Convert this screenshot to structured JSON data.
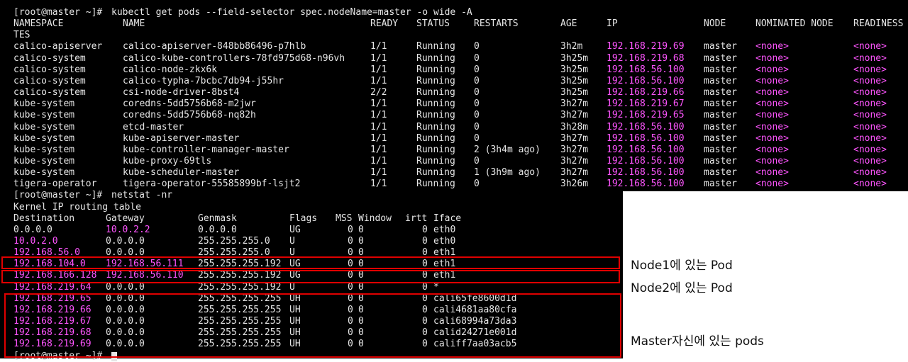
{
  "terminal": {
    "prompt1": "[root@master ~]# ",
    "cmd1": "kubectl get pods --field-selector spec.nodeName=master -o wide -A",
    "headers": {
      "namespace": "NAMESPACE",
      "name": "NAME",
      "ready": "READY",
      "status": "STATUS",
      "restarts": "RESTARTS",
      "age": "AGE",
      "ip": "IP",
      "node": "NODE",
      "nominated": "NOMINATED NODE",
      "readiness": "READINESS",
      "readiness_wrap": "TES"
    },
    "pods": [
      {
        "ns": "calico-apiserver",
        "name": "calico-apiserver-848bb86496-p7hlb",
        "ready": "1/1",
        "status": "Running",
        "restarts": "0",
        "age": "3h2m",
        "ip": "192.168.219.69",
        "node": "master",
        "nominated": "<none>",
        "readiness": "<none>"
      },
      {
        "ns": "calico-system",
        "name": "calico-kube-controllers-78fd975d68-n96vh",
        "ready": "1/1",
        "status": "Running",
        "restarts": "0",
        "age": "3h25m",
        "ip": "192.168.219.68",
        "node": "master",
        "nominated": "<none>",
        "readiness": "<none>"
      },
      {
        "ns": "calico-system",
        "name": "calico-node-zkx6k",
        "ready": "1/1",
        "status": "Running",
        "restarts": "0",
        "age": "3h25m",
        "ip": "192.168.56.100",
        "node": "master",
        "nominated": "<none>",
        "readiness": "<none>"
      },
      {
        "ns": "calico-system",
        "name": "calico-typha-7bcbc7db94-j55hr",
        "ready": "1/1",
        "status": "Running",
        "restarts": "0",
        "age": "3h25m",
        "ip": "192.168.56.100",
        "node": "master",
        "nominated": "<none>",
        "readiness": "<none>"
      },
      {
        "ns": "calico-system",
        "name": "csi-node-driver-8bst4",
        "ready": "2/2",
        "status": "Running",
        "restarts": "0",
        "age": "3h25m",
        "ip": "192.168.219.66",
        "node": "master",
        "nominated": "<none>",
        "readiness": "<none>"
      },
      {
        "ns": "kube-system",
        "name": "coredns-5dd5756b68-m2jwr",
        "ready": "1/1",
        "status": "Running",
        "restarts": "0",
        "age": "3h27m",
        "ip": "192.168.219.67",
        "node": "master",
        "nominated": "<none>",
        "readiness": "<none>"
      },
      {
        "ns": "kube-system",
        "name": "coredns-5dd5756b68-nq82h",
        "ready": "1/1",
        "status": "Running",
        "restarts": "0",
        "age": "3h27m",
        "ip": "192.168.219.65",
        "node": "master",
        "nominated": "<none>",
        "readiness": "<none>"
      },
      {
        "ns": "kube-system",
        "name": "etcd-master",
        "ready": "1/1",
        "status": "Running",
        "restarts": "0",
        "age": "3h28m",
        "ip": "192.168.56.100",
        "node": "master",
        "nominated": "<none>",
        "readiness": "<none>"
      },
      {
        "ns": "kube-system",
        "name": "kube-apiserver-master",
        "ready": "1/1",
        "status": "Running",
        "restarts": "0",
        "age": "3h27m",
        "ip": "192.168.56.100",
        "node": "master",
        "nominated": "<none>",
        "readiness": "<none>"
      },
      {
        "ns": "kube-system",
        "name": "kube-controller-manager-master",
        "ready": "1/1",
        "status": "Running",
        "restarts": "2 (3h4m ago)",
        "age": "3h27m",
        "ip": "192.168.56.100",
        "node": "master",
        "nominated": "<none>",
        "readiness": "<none>"
      },
      {
        "ns": "kube-system",
        "name": "kube-proxy-69tls",
        "ready": "1/1",
        "status": "Running",
        "restarts": "0",
        "age": "3h27m",
        "ip": "192.168.56.100",
        "node": "master",
        "nominated": "<none>",
        "readiness": "<none>"
      },
      {
        "ns": "kube-system",
        "name": "kube-scheduler-master",
        "ready": "1/1",
        "status": "Running",
        "restarts": "1 (3h9m ago)",
        "age": "3h27m",
        "ip": "192.168.56.100",
        "node": "master",
        "nominated": "<none>",
        "readiness": "<none>"
      },
      {
        "ns": "tigera-operator",
        "name": "tigera-operator-55585899bf-lsjt2",
        "ready": "1/1",
        "status": "Running",
        "restarts": "0",
        "age": "3h26m",
        "ip": "192.168.56.100",
        "node": "master",
        "nominated": "<none>",
        "readiness": "<none>"
      }
    ],
    "prompt2": "[root@master ~]# ",
    "cmd2": "netstat -nr",
    "routing_title": "Kernel IP routing table",
    "route_headers": {
      "destination": "Destination",
      "gateway": "Gateway",
      "genmask": "Genmask",
      "flags": "Flags",
      "mss": "MSS",
      "window": "Window",
      "irtt": "irtt",
      "iface": "Iface"
    },
    "routes": [
      {
        "dest": "0.0.0.0",
        "gw": "10.0.2.2",
        "mask": "0.0.0.0",
        "flags": "UG",
        "mss": "0",
        "win": "0",
        "irtt": "0",
        "iface": "eth0",
        "dest_hl": false,
        "gw_hl": true
      },
      {
        "dest": "10.0.2.0",
        "gw": "0.0.0.0",
        "mask": "255.255.255.0",
        "flags": "U",
        "mss": "0",
        "win": "0",
        "irtt": "0",
        "iface": "eth0",
        "dest_hl": true,
        "gw_hl": false
      },
      {
        "dest": "192.168.56.0",
        "gw": "0.0.0.0",
        "mask": "255.255.255.0",
        "flags": "U",
        "mss": "0",
        "win": "0",
        "irtt": "0",
        "iface": "eth1",
        "dest_hl": true,
        "gw_hl": false
      },
      {
        "dest": "192.168.104.0",
        "gw": "192.168.56.111",
        "mask": "255.255.255.192",
        "flags": "UG",
        "mss": "0",
        "win": "0",
        "irtt": "0",
        "iface": "eth1",
        "dest_hl": true,
        "gw_hl": true
      },
      {
        "dest": "192.168.166.128",
        "gw": "192.168.56.110",
        "mask": "255.255.255.192",
        "flags": "UG",
        "mss": "0",
        "win": "0",
        "irtt": "0",
        "iface": "eth1",
        "dest_hl": true,
        "gw_hl": true
      },
      {
        "dest": "192.168.219.64",
        "gw": "0.0.0.0",
        "mask": "255.255.255.192",
        "flags": "U",
        "mss": "0",
        "win": "0",
        "irtt": "0",
        "iface": "*",
        "dest_hl": true,
        "gw_hl": false
      },
      {
        "dest": "192.168.219.65",
        "gw": "0.0.0.0",
        "mask": "255.255.255.255",
        "flags": "UH",
        "mss": "0",
        "win": "0",
        "irtt": "0",
        "iface": "cali65fe8600d1d",
        "dest_hl": true,
        "gw_hl": false
      },
      {
        "dest": "192.168.219.66",
        "gw": "0.0.0.0",
        "mask": "255.255.255.255",
        "flags": "UH",
        "mss": "0",
        "win": "0",
        "irtt": "0",
        "iface": "cali4681aa80cfa",
        "dest_hl": true,
        "gw_hl": false
      },
      {
        "dest": "192.168.219.67",
        "gw": "0.0.0.0",
        "mask": "255.255.255.255",
        "flags": "UH",
        "mss": "0",
        "win": "0",
        "irtt": "0",
        "iface": "cali68994a73da3",
        "dest_hl": true,
        "gw_hl": false
      },
      {
        "dest": "192.168.219.68",
        "gw": "0.0.0.0",
        "mask": "255.255.255.255",
        "flags": "UH",
        "mss": "0",
        "win": "0",
        "irtt": "0",
        "iface": "calid24271e001d",
        "dest_hl": true,
        "gw_hl": false
      },
      {
        "dest": "192.168.219.69",
        "gw": "0.0.0.0",
        "mask": "255.255.255.255",
        "flags": "UH",
        "mss": "0",
        "win": "0",
        "irtt": "0",
        "iface": "califf7aa03acb5",
        "dest_hl": true,
        "gw_hl": false
      }
    ],
    "final_prompt": "[root@master ~]# "
  },
  "annotations": {
    "node1": "Node1에 있는 Pod",
    "node2": "Node2에 있는 Pod",
    "master": "Master자신에 있는 pods"
  },
  "colors": {
    "terminal_bg": "#000000",
    "text": "#e6e6e6",
    "highlight": "#ff55ff",
    "box": "#e00000"
  }
}
